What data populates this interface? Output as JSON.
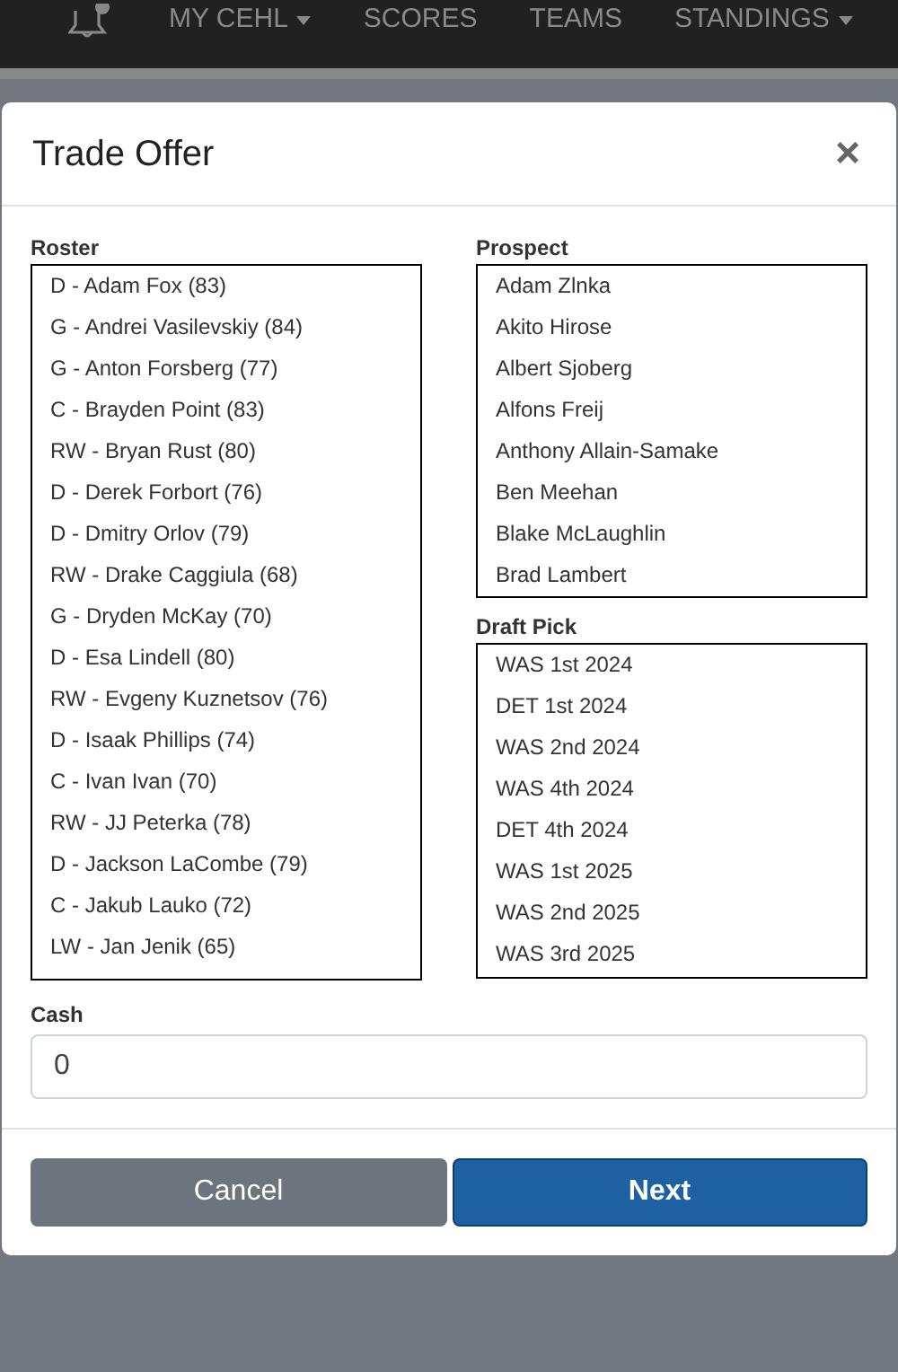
{
  "nav": {
    "items": [
      {
        "label": "MY CEHL",
        "dropdown": true
      },
      {
        "label": "SCORES",
        "dropdown": false
      },
      {
        "label": "TEAMS",
        "dropdown": false
      },
      {
        "label": "STANDINGS",
        "dropdown": true
      }
    ]
  },
  "modal": {
    "title": "Trade Offer",
    "close": "×",
    "roster": {
      "label": "Roster",
      "items": [
        "D - Adam Fox (83)",
        "G - Andrei Vasilevskiy (84)",
        "G - Anton Forsberg (77)",
        "C - Brayden Point (83)",
        "RW - Bryan Rust (80)",
        "D - Derek Forbort (76)",
        "D - Dmitry Orlov (79)",
        "RW - Drake Caggiula (68)",
        "G - Dryden McKay (70)",
        "D - Esa Lindell (80)",
        "RW - Evgeny Kuznetsov (76)",
        "D - Isaak Phillips (74)",
        "C - Ivan Ivan (70)",
        "RW - JJ Peterka (78)",
        "D - Jackson LaCombe (79)",
        "C - Jakub Lauko (72)",
        "LW - Jan Jenik (65)"
      ]
    },
    "prospect": {
      "label": "Prospect",
      "items": [
        "Adam Zlnka",
        "Akito Hirose",
        "Albert Sjoberg",
        "Alfons Freij",
        "Anthony Allain-Samake",
        "Ben Meehan",
        "Blake McLaughlin",
        "Brad Lambert"
      ]
    },
    "draft_pick": {
      "label": "Draft Pick",
      "items": [
        "WAS 1st 2024",
        "DET 1st 2024",
        "WAS 2nd 2024",
        "WAS 4th 2024",
        "DET 4th 2024",
        "WAS 1st 2025",
        "WAS 2nd 2025",
        "WAS 3rd 2025"
      ]
    },
    "cash": {
      "label": "Cash",
      "value": "0"
    },
    "buttons": [
      {
        "label": "Cancel",
        "kind": "secondary"
      },
      {
        "label": "Next",
        "kind": "primary"
      }
    ]
  }
}
